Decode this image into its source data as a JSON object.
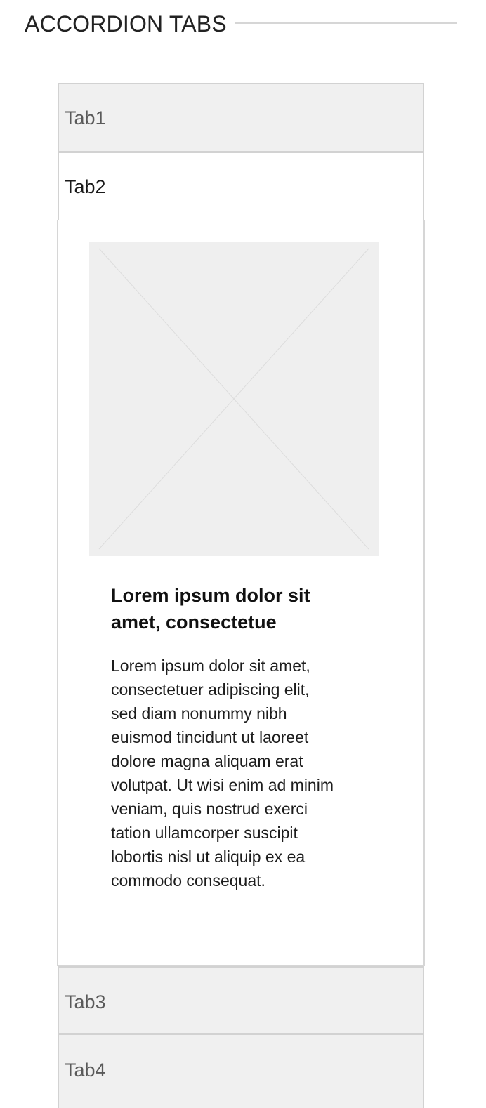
{
  "header": {
    "title": "ACCORDION TABS"
  },
  "accordion": {
    "tabs": [
      {
        "label": "Tab1"
      },
      {
        "label": "Tab2"
      },
      {
        "label": "Tab3"
      },
      {
        "label": "Tab4"
      }
    ],
    "active_tab_index": 1,
    "panel": {
      "heading": "Lorem ipsum dolor sit amet, consectetue",
      "body": "Lorem ipsum dolor sit amet, consectetuer adipiscing elit, sed diam nonummy nibh euismod tincidunt ut laoreet dolore magna aliquam erat volutpat. Ut wisi enim ad minim veniam, quis nostrud exerci tation ullamcorper suscipit lobortis nisl ut aliquip ex ea commodo consequat.",
      "image_icon": "image-placeholder-icon"
    }
  },
  "colors": {
    "tab_background": "#f0f0f0",
    "active_background": "#ffffff",
    "border": "#d2d2d2",
    "placeholder": "#efefef"
  }
}
